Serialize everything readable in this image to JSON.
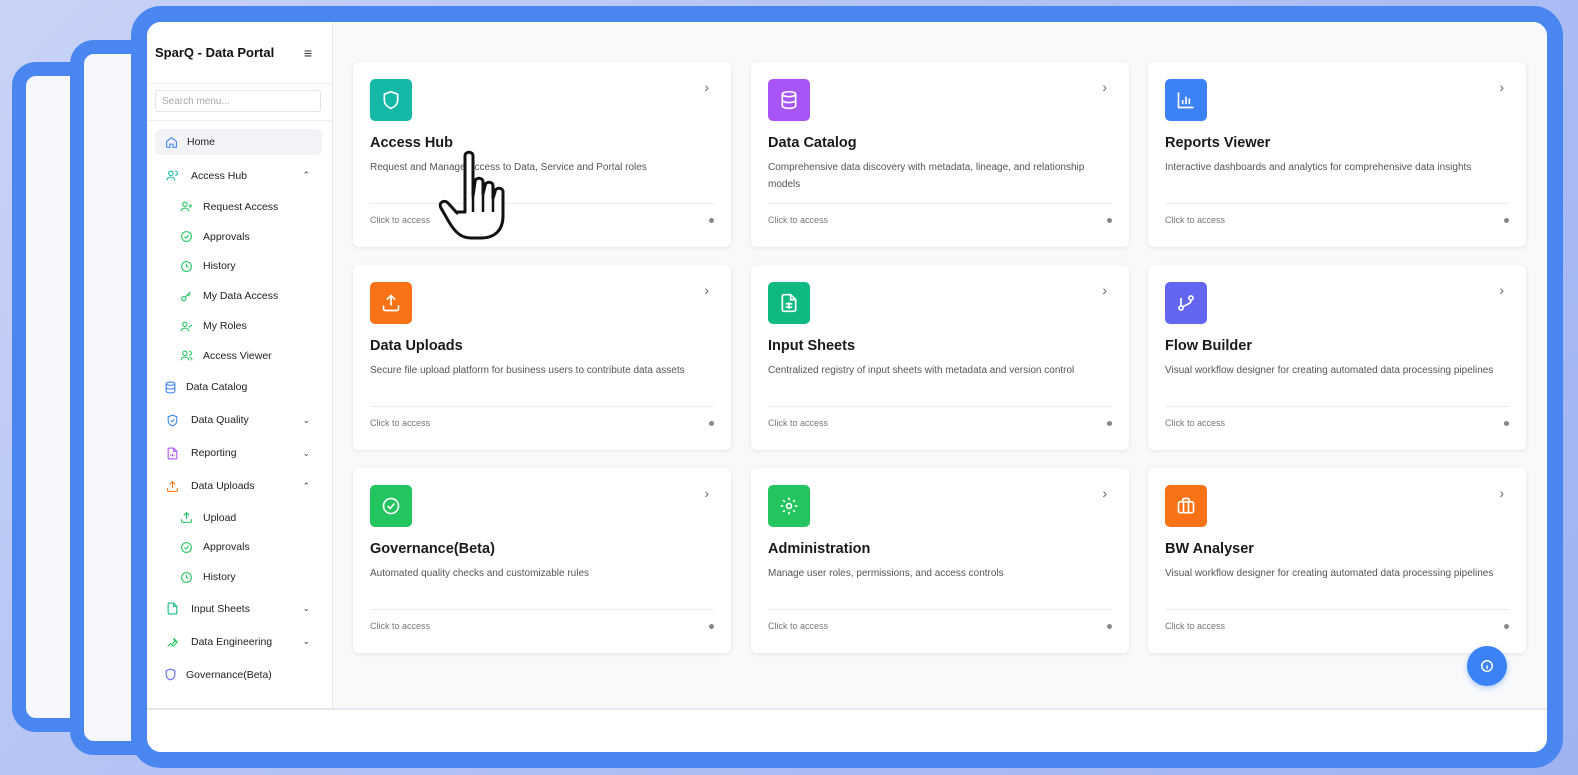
{
  "app": {
    "title": "SparQ - Data Portal"
  },
  "search": {
    "placeholder": "Search menu..."
  },
  "sidebar": {
    "items": [
      {
        "label": "Home",
        "icon": "home-icon"
      },
      {
        "label": "Access Hub",
        "icon": "users-icon",
        "expanded": true
      },
      {
        "label": "Request Access",
        "icon": "user-plus-icon"
      },
      {
        "label": "Approvals",
        "icon": "check-circle-icon"
      },
      {
        "label": "History",
        "icon": "clock-icon"
      },
      {
        "label": "My Data Access",
        "icon": "key-icon"
      },
      {
        "label": "My Roles",
        "icon": "user-check-icon"
      },
      {
        "label": "Access Viewer",
        "icon": "users-icon"
      },
      {
        "label": "Data Catalog",
        "icon": "database-icon"
      },
      {
        "label": "Data Quality",
        "icon": "shield-icon",
        "expanded": false
      },
      {
        "label": "Reporting",
        "icon": "file-chart-icon",
        "expanded": false
      },
      {
        "label": "Data Uploads",
        "icon": "upload-icon",
        "expanded": true
      },
      {
        "label": "Upload",
        "icon": "upload-icon"
      },
      {
        "label": "Approvals",
        "icon": "check-circle-icon"
      },
      {
        "label": "History",
        "icon": "clock-icon"
      },
      {
        "label": "Input Sheets",
        "icon": "file-icon",
        "expanded": false
      },
      {
        "label": "Data Engineering",
        "icon": "wrench-icon",
        "expanded": false
      },
      {
        "label": "Governance(Beta)",
        "icon": "shield-icon"
      }
    ]
  },
  "cards": [
    {
      "title": "Access Hub",
      "desc": "Request and Manage Access to Data, Service and Portal roles",
      "footer": "Click to access",
      "icon": "shield-icon",
      "color": "#14b8a6"
    },
    {
      "title": "Data Catalog",
      "desc": "Comprehensive data discovery with metadata, lineage, and relationship models",
      "footer": "Click to access",
      "icon": "database-icon",
      "color": "#a855f7"
    },
    {
      "title": "Reports Viewer",
      "desc": "Interactive dashboards and analytics for comprehensive data insights",
      "footer": "Click to access",
      "icon": "bar-chart-icon",
      "color": "#3b82f6"
    },
    {
      "title": "Data Uploads",
      "desc": "Secure file upload platform for business users to contribute data assets",
      "footer": "Click to access",
      "icon": "upload-icon",
      "color": "#f97316"
    },
    {
      "title": "Input Sheets",
      "desc": "Centralized registry of input sheets with metadata and version control",
      "footer": "Click to access",
      "icon": "sheet-icon",
      "color": "#10b981"
    },
    {
      "title": "Flow Builder",
      "desc": "Visual workflow designer for creating automated data processing pipelines",
      "footer": "Click to access",
      "icon": "git-branch-icon",
      "color": "#6366f1"
    },
    {
      "title": "Governance(Beta)",
      "desc": "Automated quality checks and customizable rules",
      "footer": "Click to access",
      "icon": "check-circle-icon",
      "color": "#22c55e"
    },
    {
      "title": "Administration",
      "desc": "Manage user roles, permissions, and access controls",
      "footer": "Click to access",
      "icon": "gear-icon",
      "color": "#22c55e"
    },
    {
      "title": "BW Analyser",
      "desc": "Visual workflow designer for creating automated data processing pipelines",
      "footer": "Click to access",
      "icon": "briefcase-icon",
      "color": "#f97316"
    }
  ],
  "help": {
    "icon": "info-icon"
  }
}
